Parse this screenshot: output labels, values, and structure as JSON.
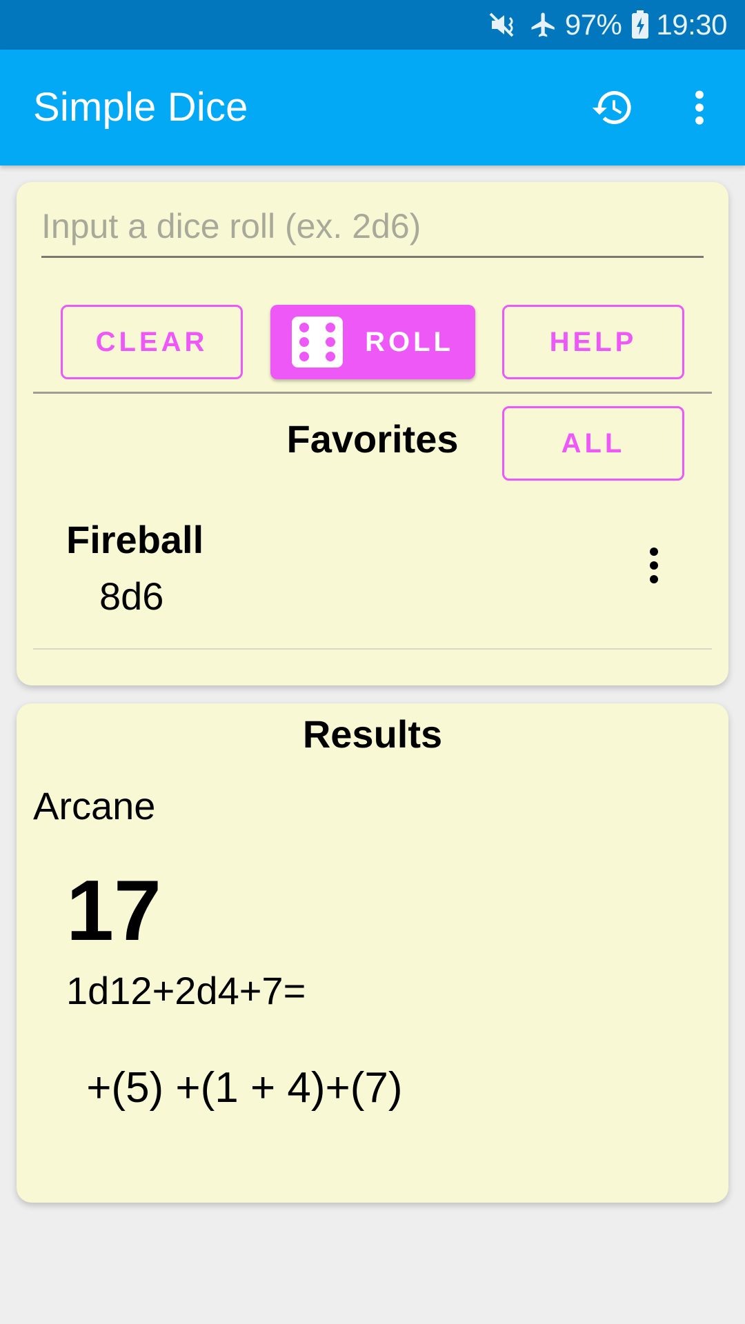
{
  "status_bar": {
    "battery": "97%",
    "time": "19:30",
    "icons": [
      "vibrate-mute-icon",
      "airplane-mode-icon",
      "battery-charging-icon"
    ]
  },
  "app_bar": {
    "title": "Simple Dice",
    "actions": [
      "history-icon",
      "overflow-menu-icon"
    ]
  },
  "input_card": {
    "input_value": "",
    "input_placeholder": "Input a dice roll (ex. 2d6)",
    "clear_label": "CLEAR",
    "roll_label": "ROLL",
    "help_label": "HELP",
    "favorites_title": "Favorites",
    "all_label": "ALL",
    "favorites": [
      {
        "name": "Fireball",
        "roll": "8d6"
      }
    ]
  },
  "results_card": {
    "title": "Results",
    "label": "Arcane",
    "total": "17",
    "expression": "1d12+2d4+7=",
    "breakdown": " +(5) +(1 + 4)+(7)"
  },
  "colors": {
    "status_bar": "#0277bd",
    "app_bar": "#03a9f4",
    "accent": "#ee58f7",
    "card": "#f8f8d4",
    "background": "#eeeeee"
  }
}
